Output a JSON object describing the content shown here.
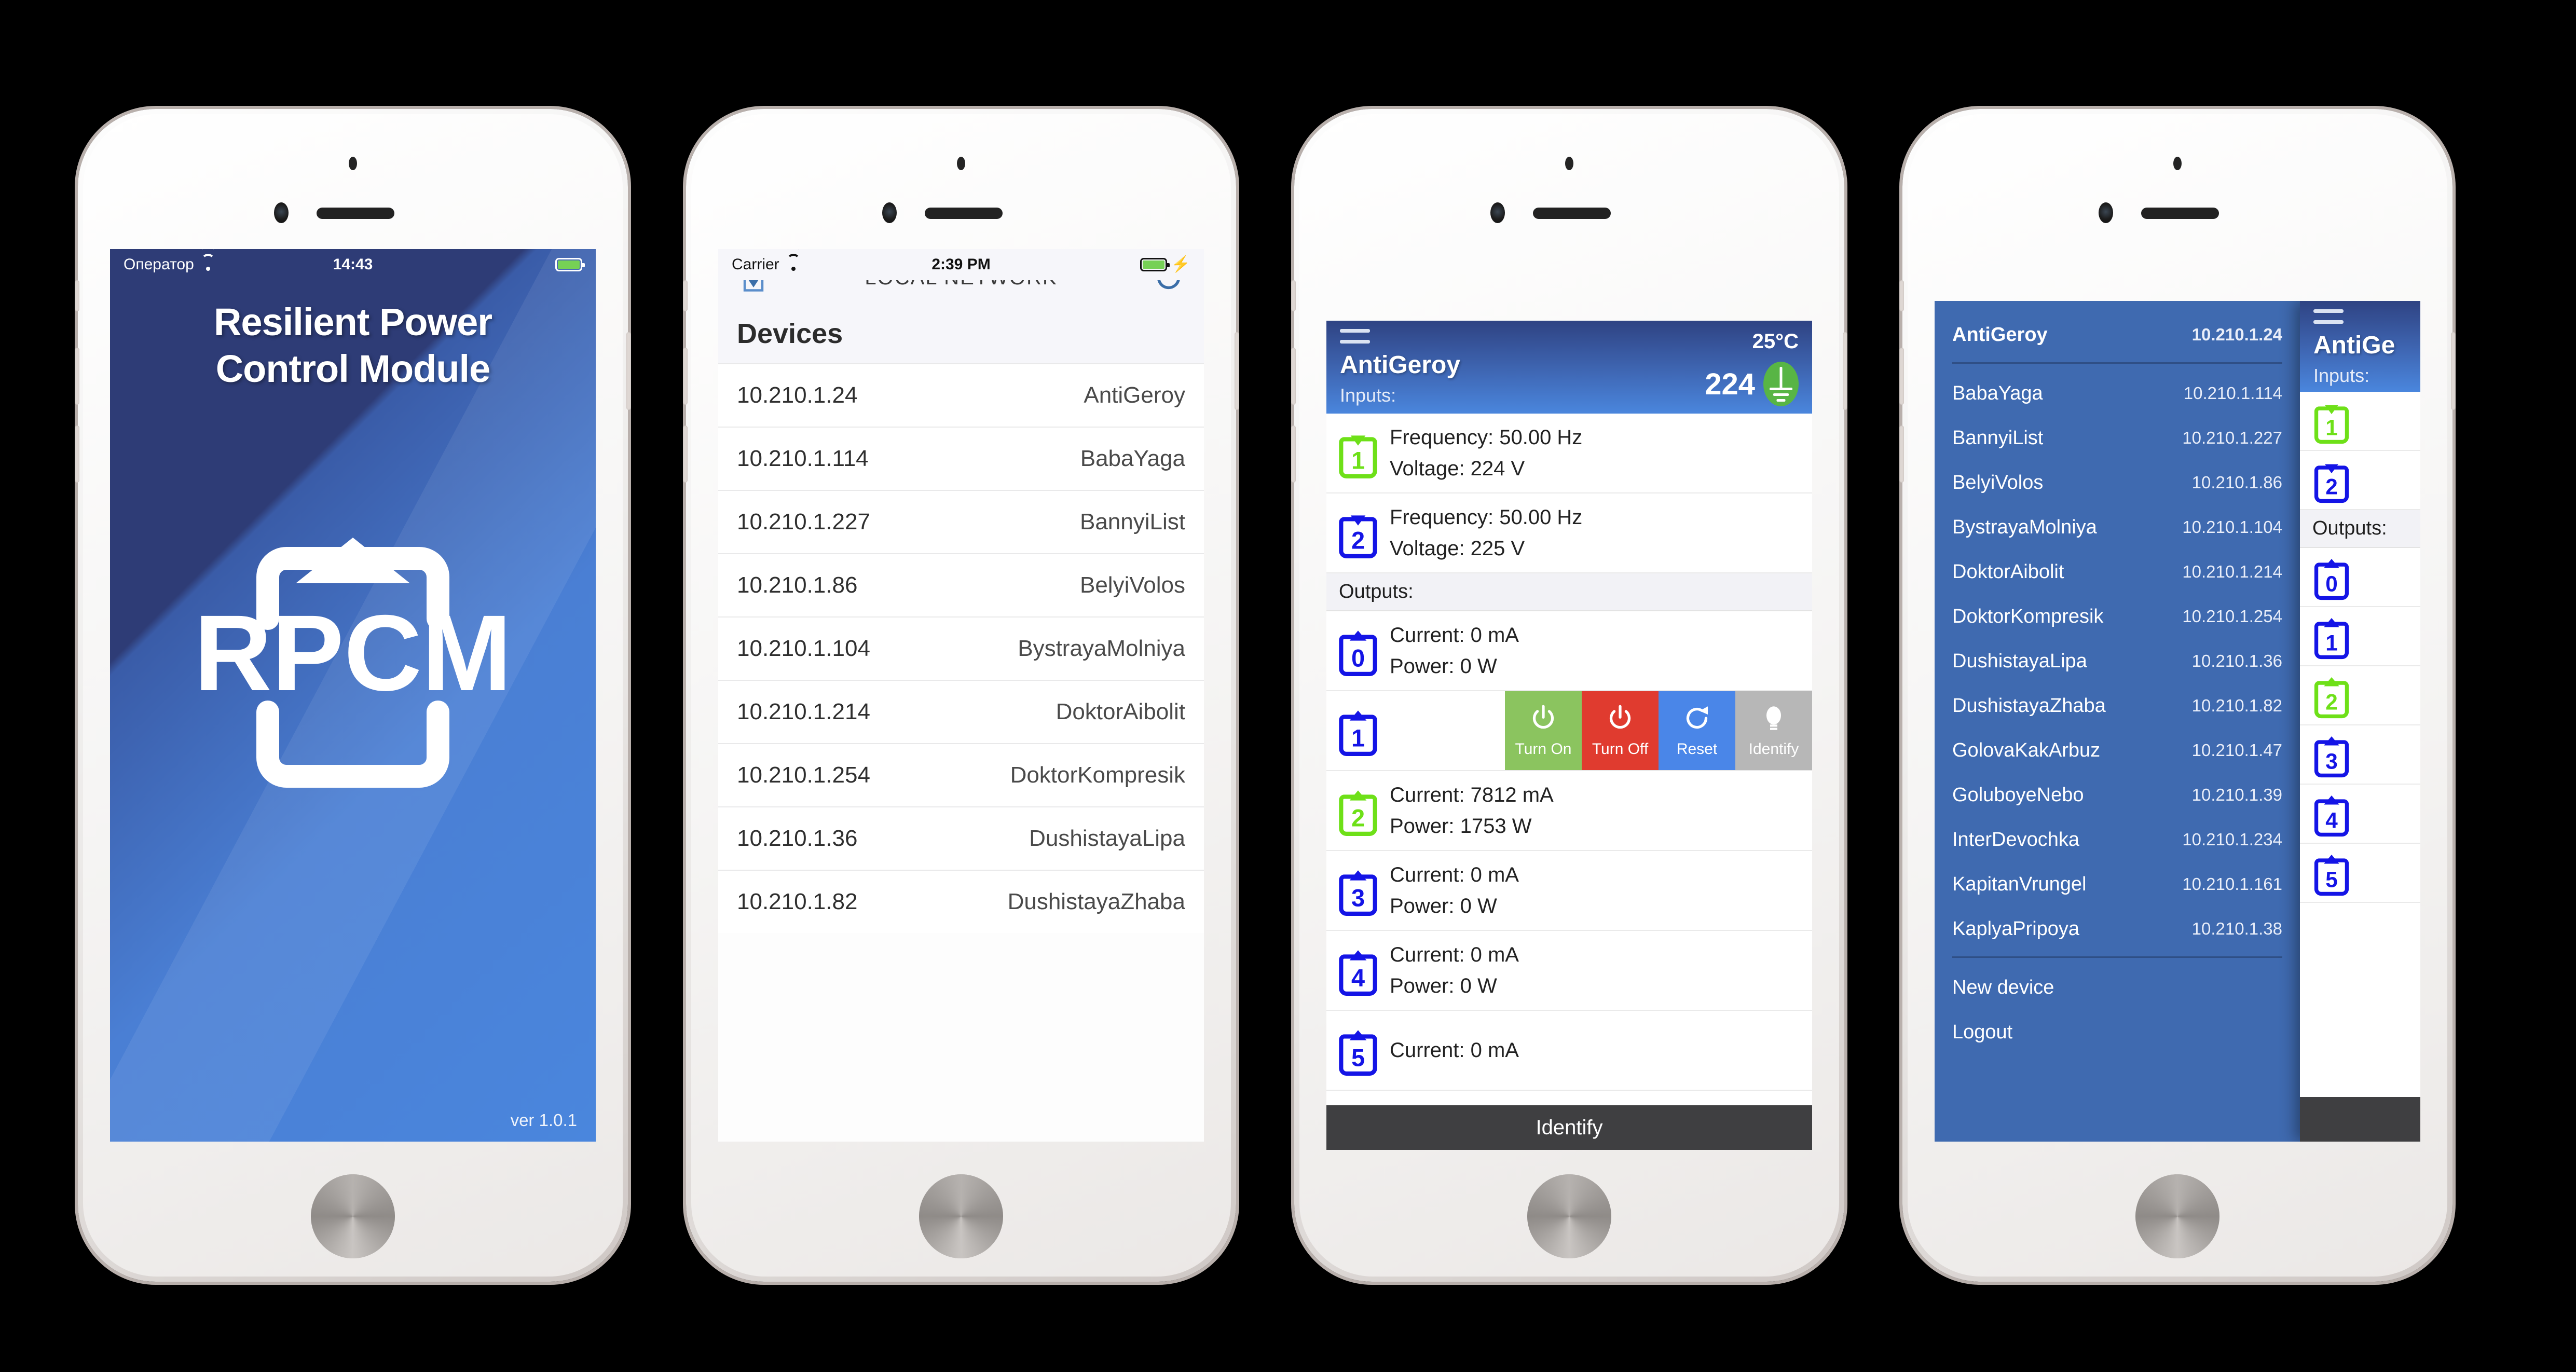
{
  "colors": {
    "brand_blue": "#3f6ab0",
    "header_dark": "#2f4383",
    "header_light": "#4a86dd",
    "green": "#6ee018",
    "blue_icon": "#1414e6",
    "turn_on": "#8bc45f",
    "turn_off": "#e03b2f",
    "reset": "#4a86e8",
    "identify": "#b7b7b7",
    "toolbar": "#3f3f41"
  },
  "phone1": {
    "status": {
      "carrier": "Оператор",
      "time": "14:43",
      "wifi_icon": "wifi-icon",
      "battery_icon": "battery-icon"
    },
    "splash": {
      "title_line1": "Resilient Power",
      "title_line2": "Control Module",
      "logo_text": "RPCM",
      "version": "ver 1.0.1"
    }
  },
  "phone2": {
    "status": {
      "carrier": "Carrier",
      "time": "2:39 PM",
      "wifi_icon": "wifi-icon",
      "battery_icon": "battery-icon",
      "charging_icon": "bolt-icon"
    },
    "nav": {
      "title": "LOCAL NETWORK",
      "left_icon": "import-icon",
      "right_icon": "refresh-icon"
    },
    "section_title": "Devices",
    "devices": [
      {
        "ip": "10.210.1.24",
        "name": "AntiGeroy"
      },
      {
        "ip": "10.210.1.114",
        "name": "BabaYaga"
      },
      {
        "ip": "10.210.1.227",
        "name": "BannyiList"
      },
      {
        "ip": "10.210.1.86",
        "name": "BelyiVolos"
      },
      {
        "ip": "10.210.1.104",
        "name": "BystrayaMolniya"
      },
      {
        "ip": "10.210.1.214",
        "name": "DoktorAibolit"
      },
      {
        "ip": "10.210.1.254",
        "name": "DoktorKompresik"
      },
      {
        "ip": "10.210.1.36",
        "name": "DushistayaLipa"
      },
      {
        "ip": "10.210.1.82",
        "name": "DushistayaZhaba"
      }
    ]
  },
  "phone3": {
    "header": {
      "menu_icon": "hamburger-icon",
      "temperature": "25°C",
      "device_name": "AntiGeroy",
      "inputs_label": "Inputs:",
      "voltage_summary": "224",
      "ground_icon": "ground-icon"
    },
    "inputs": [
      {
        "num": "1",
        "state": "green",
        "frequency": "Frequency: 50.00 Hz",
        "voltage": "Voltage: 224 V"
      },
      {
        "num": "2",
        "state": "blue",
        "frequency": "Frequency: 50.00 Hz",
        "voltage": "Voltage: 225 V"
      }
    ],
    "outputs_label": "Outputs:",
    "outputs": [
      {
        "num": "0",
        "state": "blue",
        "current": "Current: 0 mA",
        "power": "Power: 0 W",
        "swiped": false
      },
      {
        "num": "1",
        "state": "blue",
        "current": "",
        "power": "",
        "swiped": true
      },
      {
        "num": "2",
        "state": "green",
        "current": "Current: 7812 mA",
        "power": "Power: 1753 W",
        "swiped": false
      },
      {
        "num": "3",
        "state": "blue",
        "current": "Current: 0 mA",
        "power": "Power: 0 W",
        "swiped": false
      },
      {
        "num": "4",
        "state": "blue",
        "current": "Current: 0 mA",
        "power": "Power: 0 W",
        "swiped": false
      },
      {
        "num": "5",
        "state": "blue",
        "current": "Current: 0 mA",
        "power": "",
        "swiped": false
      }
    ],
    "swipe_actions": [
      {
        "label": "Turn On",
        "icon": "power-icon",
        "color": "#8bc45f"
      },
      {
        "label": "Turn Off",
        "icon": "power-icon",
        "color": "#e03b2f"
      },
      {
        "label": "Reset",
        "icon": "refresh-icon",
        "color": "#4a86e8"
      },
      {
        "label": "Identify",
        "icon": "lightbulb-icon",
        "color": "#b7b7b7"
      }
    ],
    "toolbar": {
      "identify_label": "Identify"
    }
  },
  "phone4": {
    "drawer": {
      "items": [
        {
          "name": "AntiGeroy",
          "ip": "10.210.1.24",
          "active": true
        },
        {
          "name": "BabaYaga",
          "ip": "10.210.1.114",
          "active": false
        },
        {
          "name": "BannyiList",
          "ip": "10.210.1.227",
          "active": false
        },
        {
          "name": "BelyiVolos",
          "ip": "10.210.1.86",
          "active": false
        },
        {
          "name": "BystrayaMolniya",
          "ip": "10.210.1.104",
          "active": false
        },
        {
          "name": "DoktorAibolit",
          "ip": "10.210.1.214",
          "active": false
        },
        {
          "name": "DoktorKompresik",
          "ip": "10.210.1.254",
          "active": false
        },
        {
          "name": "DushistayaLipa",
          "ip": "10.210.1.36",
          "active": false
        },
        {
          "name": "DushistayaZhaba",
          "ip": "10.210.1.82",
          "active": false
        },
        {
          "name": "GolovaKakArbuz",
          "ip": "10.210.1.47",
          "active": false
        },
        {
          "name": "GoluboyeNebo",
          "ip": "10.210.1.39",
          "active": false
        },
        {
          "name": "InterDevochka",
          "ip": "10.210.1.234",
          "active": false
        },
        {
          "name": "KapitanVrungel",
          "ip": "10.210.1.161",
          "active": false
        },
        {
          "name": "KaplyaPripoya",
          "ip": "10.210.1.38",
          "active": false
        }
      ],
      "new_device": "New device",
      "logout": "Logout"
    },
    "peek": {
      "menu_icon": "hamburger-icon",
      "device_name": "AntiGe",
      "inputs_label": "Inputs:",
      "outputs_label": "Outputs:",
      "input_icons": [
        {
          "num": "1",
          "state": "green"
        },
        {
          "num": "2",
          "state": "blue"
        }
      ],
      "output_icons": [
        {
          "num": "0",
          "state": "blue"
        },
        {
          "num": "1",
          "state": "blue"
        },
        {
          "num": "2",
          "state": "green"
        },
        {
          "num": "3",
          "state": "blue"
        },
        {
          "num": "4",
          "state": "blue"
        },
        {
          "num": "5",
          "state": "blue"
        }
      ]
    }
  }
}
